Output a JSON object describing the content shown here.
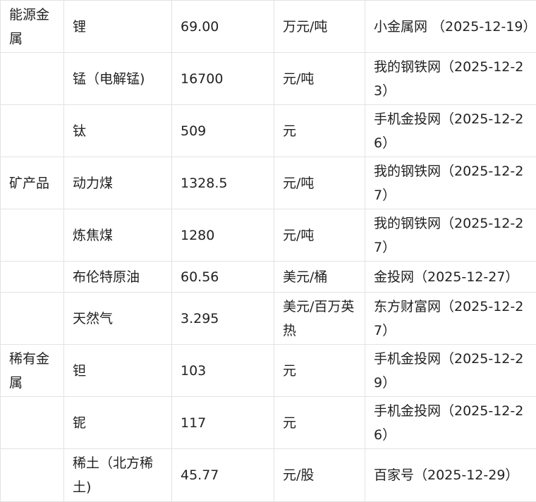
{
  "table": {
    "rows": [
      {
        "category": "能源金属",
        "item": "锂",
        "price": "69.00",
        "unit": "万元/吨",
        "source": "小金属网 （2025-12-19）"
      },
      {
        "category": "",
        "item": "锰（电解锰)",
        "price": "16700",
        "unit": "元/吨",
        "source": "我的钢铁网（2025-12-23）"
      },
      {
        "category": "",
        "item": "钛",
        "price": "509",
        "unit": "元",
        "source": "手机金投网（2025-12-26）"
      },
      {
        "category": "矿产品",
        "item": "动力煤",
        "price": "1328.5",
        "unit": "元/吨",
        "source": "我的钢铁网（2025-12-27）"
      },
      {
        "category": "",
        "item": "炼焦煤",
        "price": "1280",
        "unit": "元/吨",
        "source": "我的钢铁网（2025-12-27）"
      },
      {
        "category": "",
        "item": "布伦特原油",
        "price": "60.56",
        "unit": "美元/桶",
        "source": "金投网（2025-12-27）"
      },
      {
        "category": "",
        "item": "天然气",
        "price": "3.295",
        "unit": "美元/百万英热",
        "source": "东方财富网（2025-12-27）"
      },
      {
        "category": "稀有金属",
        "item": "钽",
        "price": "103",
        "unit": "元",
        "source": "手机金投网（2025-12-29）"
      },
      {
        "category": "",
        "item": "铌",
        "price": "117",
        "unit": "元",
        "source": "手机金投网（2025-12-26）"
      },
      {
        "category": "",
        "item": "稀土（北方稀土)",
        "price": "45.77",
        "unit": "元/股",
        "source": "百家号（2025-12-29）"
      }
    ]
  }
}
